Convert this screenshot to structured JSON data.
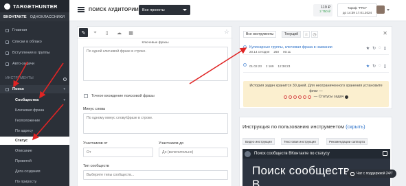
{
  "sidebar": {
    "logo": "TARGETHUNTER",
    "tabs": [
      "ВКОНТАКТЕ",
      "ОДНОКЛАССНИКИ"
    ],
    "items": [
      {
        "label": "Главная",
        "icon": "home-icon"
      },
      {
        "label": "Списки в облако",
        "icon": "cloud-icon"
      },
      {
        "label": "Вступления в группы",
        "icon": "group-icon"
      },
      {
        "label": "Авто-задачи",
        "icon": "task-icon"
      }
    ],
    "section": "ИНСТРУМЕНТЫ",
    "search": "Поиск",
    "communities": "Сообщества",
    "sub": [
      "Ключевая фраза",
      "Геоположение",
      "По адресу",
      "Статус",
      "Описание",
      "Проветей",
      "Дата создания",
      "По приросту"
    ]
  },
  "header": {
    "page_title": "ПОИСК АУДИТОРИИ",
    "project": "Все проекты",
    "balance": "119 ₽",
    "balance_sub": "2 750 ₽",
    "tariff_line1": "Тариф \"PRO\"",
    "tariff_line2": "до 14:39 17.01.2024"
  },
  "form": {
    "keywords_label": "Ключевые фразы",
    "keywords_placeholder": "По одной ключевой фразе в строке.",
    "exact_label": "Точное вхождение поисковой фразы",
    "minus_label": "Минус слова",
    "minus_placeholder": "По одному минус слову/фразе в строке.",
    "members_from_label": "Участников от",
    "members_from_placeholder": "От",
    "members_to_label": "Участников до",
    "members_to_placeholder": "До (включительно)",
    "type_label": "Тип сообществ",
    "type_placeholder": "Выберите типы сообществ..."
  },
  "tasks": {
    "tab_all": "Все инструменты",
    "tab_current": "Текущий",
    "list": [
      {
        "title": "Кулинарные группы, ключевая фраза в названии",
        "date": "20.14 сегодня",
        "count": "260",
        "time": "00:11"
      },
      {
        "title": "",
        "date": "01.02.23",
        "count": "2 169",
        "time": "12:38:23"
      }
    ],
    "notice": "История задач хранится 30 дней. Для неограниченного хранения установите флаг —",
    "status_label": "— Статусы задач"
  },
  "instruction": {
    "title": "Инструкция по пользованию инструментом",
    "link": "(скрыть)",
    "tabs": [
      "Видео инструкция",
      "Текстовая инструкция",
      "Рекомендации саппорта"
    ],
    "video_title": "Поиск сообществ ВКонтакте по статусу",
    "video_text": "Поиск сообществ",
    "video_text2": "В"
  },
  "chat": "Чат с поддержкой 24/7"
}
